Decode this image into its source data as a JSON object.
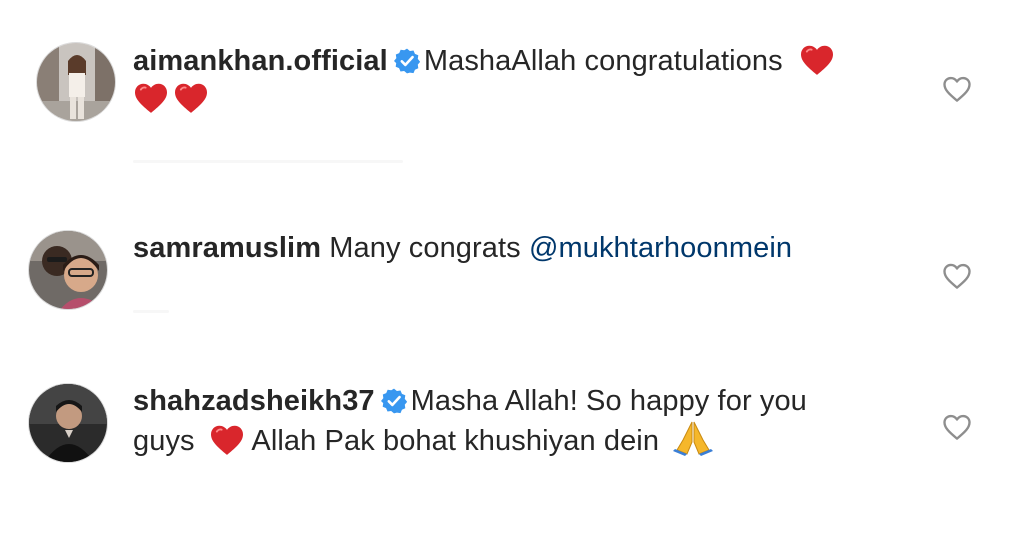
{
  "comments": [
    {
      "username": "aimankhan.official",
      "verified": true,
      "text_line1": "MashaAllah congratulations",
      "emojis": [
        "red-heart",
        "red-heart",
        "red-heart"
      ]
    },
    {
      "username": "samramuslim",
      "verified": false,
      "text": "Many congrats",
      "mention": "@mukhtarhoonmein"
    },
    {
      "username": "shahzadsheikh37",
      "verified": true,
      "text_line1": "Masha Allah! So happy for you",
      "text_line2a": "guys",
      "text_line2b": "Allah Pak bohat khushiyan dein",
      "emojis": [
        "red-heart",
        "folded-hands"
      ]
    }
  ],
  "colors": {
    "text": "#262626",
    "mention": "#00376b",
    "verified": "#3897f0",
    "heart": "#e0245e",
    "icon": "#8e8e8e"
  },
  "icons": {
    "like": "heart-outline-icon",
    "verified": "verified-badge-icon"
  }
}
